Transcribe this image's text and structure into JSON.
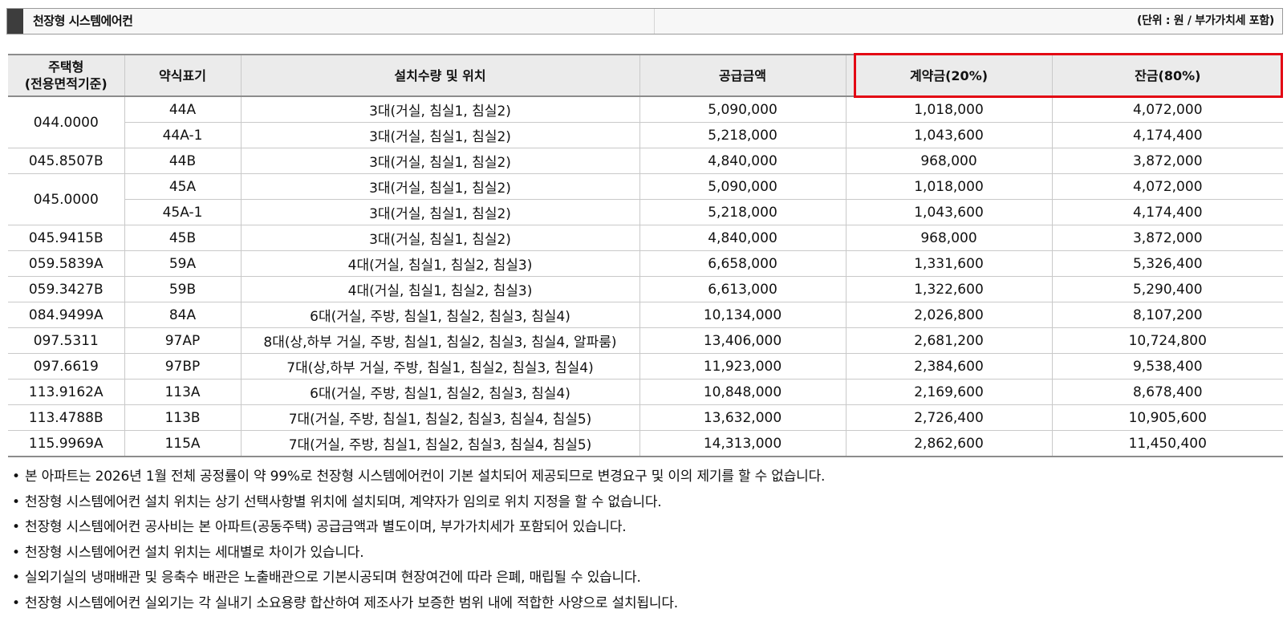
{
  "header": {
    "title": "천장형 시스템에어컨",
    "unit_note": "(단위 : 원 / 부가가치세 포함)"
  },
  "table": {
    "headers": {
      "housing_type": [
        "주택형",
        "(전용면적기준)"
      ],
      "abbr": "약식표기",
      "install": "설치수량 및 위치",
      "supply": "공급금액",
      "deposit": "계약금(20%)",
      "balance": "잔금(80%)"
    },
    "groups": [
      {
        "type": "044.0000",
        "rows": [
          {
            "abbr": "44A",
            "install": "3대(거실, 침실1, 침실2)",
            "supply": "5,090,000",
            "deposit": "1,018,000",
            "balance": "4,072,000"
          },
          {
            "abbr": "44A-1",
            "install": "3대(거실, 침실1, 침실2)",
            "supply": "5,218,000",
            "deposit": "1,043,600",
            "balance": "4,174,400"
          }
        ]
      },
      {
        "type": "045.8507B",
        "rows": [
          {
            "abbr": "44B",
            "install": "3대(거실, 침실1, 침실2)",
            "supply": "4,840,000",
            "deposit": "968,000",
            "balance": "3,872,000"
          }
        ]
      },
      {
        "type": "045.0000",
        "rows": [
          {
            "abbr": "45A",
            "install": "3대(거실, 침실1, 침실2)",
            "supply": "5,090,000",
            "deposit": "1,018,000",
            "balance": "4,072,000"
          },
          {
            "abbr": "45A-1",
            "install": "3대(거실, 침실1, 침실2)",
            "supply": "5,218,000",
            "deposit": "1,043,600",
            "balance": "4,174,400"
          }
        ]
      },
      {
        "type": "045.9415B",
        "rows": [
          {
            "abbr": "45B",
            "install": "3대(거실, 침실1, 침실2)",
            "supply": "4,840,000",
            "deposit": "968,000",
            "balance": "3,872,000"
          }
        ]
      },
      {
        "type": "059.5839A",
        "rows": [
          {
            "abbr": "59A",
            "install": "4대(거실, 침실1, 침실2, 침실3)",
            "supply": "6,658,000",
            "deposit": "1,331,600",
            "balance": "5,326,400"
          }
        ]
      },
      {
        "type": "059.3427B",
        "rows": [
          {
            "abbr": "59B",
            "install": "4대(거실, 침실1, 침실2, 침실3)",
            "supply": "6,613,000",
            "deposit": "1,322,600",
            "balance": "5,290,400"
          }
        ]
      },
      {
        "type": "084.9499A",
        "rows": [
          {
            "abbr": "84A",
            "install": "6대(거실, 주방, 침실1, 침실2, 침실3, 침실4)",
            "supply": "10,134,000",
            "deposit": "2,026,800",
            "balance": "8,107,200"
          }
        ]
      },
      {
        "type": "097.5311",
        "rows": [
          {
            "abbr": "97AP",
            "install": "8대(상,하부 거실, 주방, 침실1, 침실2, 침실3, 침실4, 알파룸)",
            "supply": "13,406,000",
            "deposit": "2,681,200",
            "balance": "10,724,800"
          }
        ]
      },
      {
        "type": "097.6619",
        "rows": [
          {
            "abbr": "97BP",
            "install": "7대(상,하부 거실, 주방, 침실1, 침실2, 침실3, 침실4)",
            "supply": "11,923,000",
            "deposit": "2,384,600",
            "balance": "9,538,400"
          }
        ]
      },
      {
        "type": "113.9162A",
        "rows": [
          {
            "abbr": "113A",
            "install": "6대(거실, 주방, 침실1, 침실2, 침실3, 침실4)",
            "supply": "10,848,000",
            "deposit": "2,169,600",
            "balance": "8,678,400"
          }
        ]
      },
      {
        "type": "113.4788B",
        "rows": [
          {
            "abbr": "113B",
            "install": "7대(거실, 주방, 침실1, 침실2, 침실3, 침실4, 침실5)",
            "supply": "13,632,000",
            "deposit": "2,726,400",
            "balance": "10,905,600"
          }
        ]
      },
      {
        "type": "115.9969A",
        "rows": [
          {
            "abbr": "115A",
            "install": "7대(거실, 주방, 침실1, 침실2, 침실3, 침실4, 침실5)",
            "supply": "14,313,000",
            "deposit": "2,862,600",
            "balance": "11,450,400"
          }
        ]
      }
    ]
  },
  "highlight_color": "#e30613",
  "notes": {
    "bullet": "•",
    "items": [
      "본 아파트는 2026년 1월 전체 공정률이 약 99%로 천장형 시스템에어컨이 기본 설치되어 제공되므로 변경요구 및 이의 제기를 할 수 없습니다.",
      "천장형 시스템에어컨 설치 위치는 상기 선택사항별 위치에 설치되며, 계약자가 임의로 위치 지정을 할 수 없습니다.",
      "천장형 시스템에어컨 공사비는 본 아파트(공동주택) 공급금액과 별도이며, 부가가치세가 포함되어 있습니다.",
      "천장형 시스템에어컨 설치 위치는 세대별로 차이가 있습니다.",
      "실외기실의 냉매배관 및 응축수 배관은 노출배관으로 기본시공되며 현장여건에 따라 은폐, 매립될 수 있습니다.",
      "천장형 시스템에어컨 실외기는 각 실내기 소요용량 합산하여 제조사가 보증한 범위 내에 적합한 사양으로 설치됩니다."
    ]
  }
}
